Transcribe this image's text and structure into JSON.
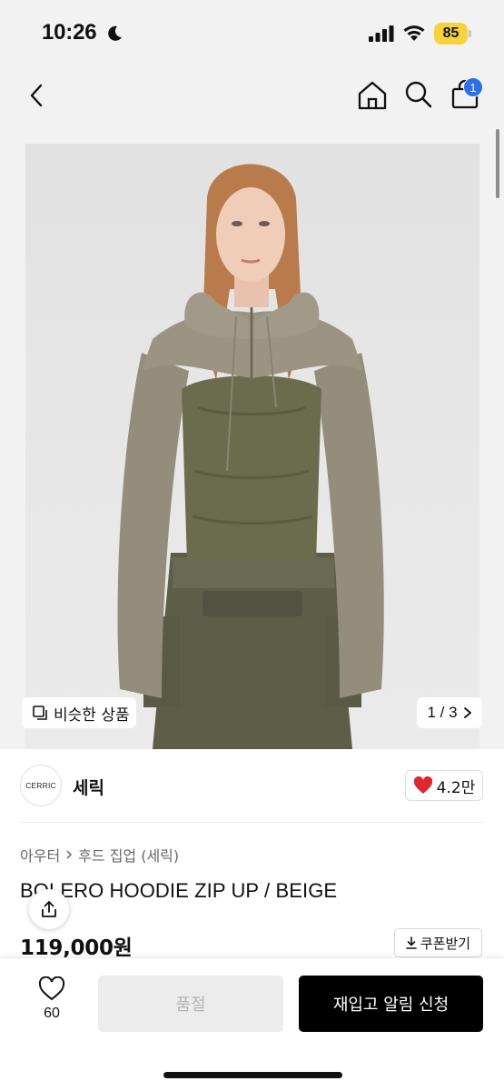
{
  "status": {
    "time": "10:26",
    "battery": "85"
  },
  "nav": {
    "cart_count": "1"
  },
  "image": {
    "similar_label": "비슷한 상품",
    "pager": "1 / 3"
  },
  "brand": {
    "logo_text": "CERRIC",
    "name": "세릭",
    "likes": "4.2만"
  },
  "product": {
    "category": [
      "아우터",
      "후드 집업 (세릭)"
    ],
    "title": "BOLERO HOODIE ZIP UP / BEIGE",
    "price": "119,000원",
    "coupon_label": "쿠폰받기"
  },
  "bottom": {
    "wish_count": "60",
    "soldout_label": "품절",
    "restock_label": "재입고 알림 신청"
  },
  "colors": {
    "accent_badge": "#2a6ff0",
    "heart": "#e0262f",
    "battery": "#f7d33a",
    "primary_button": "#000000"
  },
  "icons": [
    "moon-icon",
    "signal-icon",
    "wifi-icon",
    "back-icon",
    "home-icon",
    "search-icon",
    "bag-icon",
    "similar-icon",
    "chevron-right-icon",
    "heart-filled-icon",
    "share-icon",
    "download-icon",
    "heart-outline-icon"
  ]
}
